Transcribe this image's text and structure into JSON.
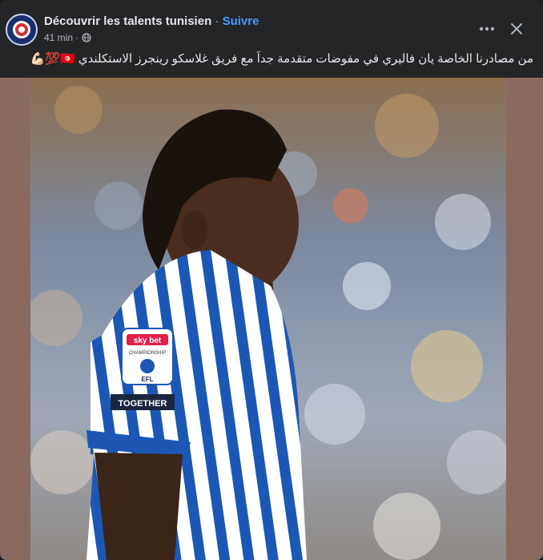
{
  "post": {
    "page_name": "Découvrir les talents tunisien",
    "separator": "·",
    "follow_label": "Suivre",
    "time": "41 min",
    "privacy_icon": "globe-icon",
    "caption": "من مصادرنا الخاصة يان فاليري في مفوضات متقدمة جداً مع فريق غلاسكو رينجرز الاستكلندي 🇹🇳💯💪🏻"
  },
  "actions": {
    "more_icon": "more-horizontal-icon",
    "close_icon": "close-icon"
  },
  "photo": {
    "shirt_badge_brand": "sky bet",
    "shirt_badge_sub": "CHAMPIONSHIP",
    "shirt_badge_league": "EFL",
    "shirt_sleeve_text": "TOGETHER"
  },
  "colors": {
    "background": "#242526",
    "text_primary": "#e4e6eb",
    "text_secondary": "#b0b3b8",
    "link": "#4599ff",
    "media_frame": "#8a6a5f",
    "kit_blue": "#1d57b5"
  }
}
